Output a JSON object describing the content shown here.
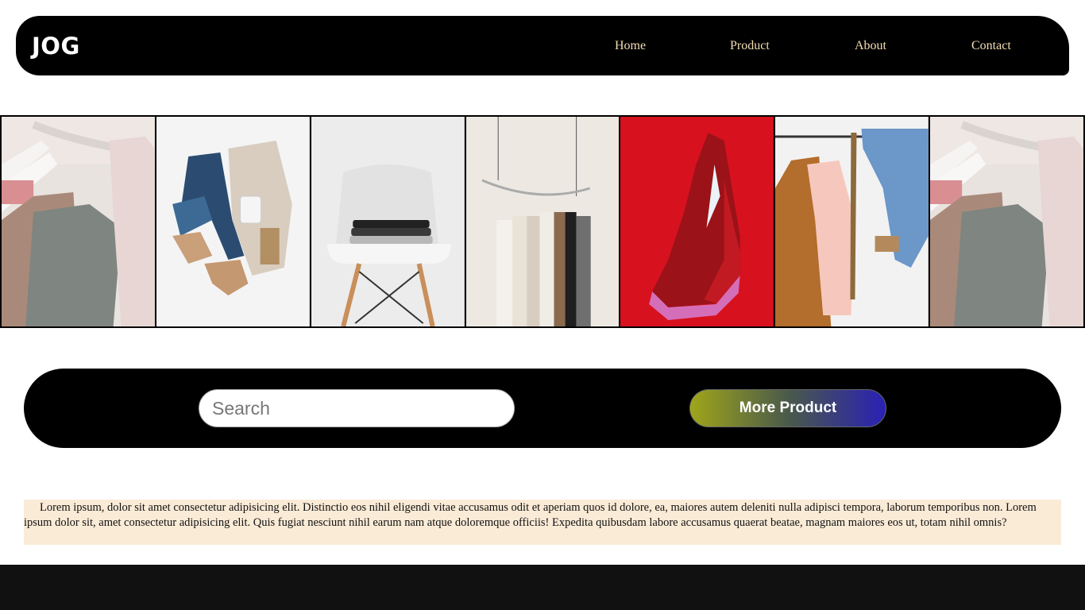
{
  "header": {
    "logo": "JOG",
    "nav": [
      {
        "label": "Home"
      },
      {
        "label": "Product"
      },
      {
        "label": "About"
      },
      {
        "label": "Contact"
      }
    ]
  },
  "gallery": {
    "images": [
      {
        "name": "clothes-rack-photo"
      },
      {
        "name": "flatlay-outfit-photo"
      },
      {
        "name": "folded-clothes-chair-photo"
      },
      {
        "name": "hanging-dresses-photo"
      },
      {
        "name": "red-sneaker-photo"
      },
      {
        "name": "jacket-jeans-rack-photo"
      },
      {
        "name": "clothes-rack-photo-repeat"
      }
    ]
  },
  "search": {
    "placeholder": "Search",
    "button_label": "More Product"
  },
  "description": {
    "text": "Lorem ipsum, dolor sit amet consectetur adipisicing elit. Distinctio eos nihil eligendi vitae accusamus odit et aperiam quos id dolore, ea, maiores autem deleniti nulla adipisci tempora, laborum temporibus non. Lorem ipsum dolor sit, amet consectetur adipisicing elit. Quis fugiat nesciunt nihil earum nam atque doloremque officiis! Expedita quibusdam labore accusamus quaerat beatae, magnam maiores eos ut, totam nihil omnis?"
  },
  "colors": {
    "nav_bg": "#000000",
    "nav_link": "#f5deb3",
    "description_bg": "#faebd7",
    "button_gradient_start": "#9fa61a",
    "button_gradient_end": "#2a20b5",
    "footer_bg": "#111111"
  }
}
